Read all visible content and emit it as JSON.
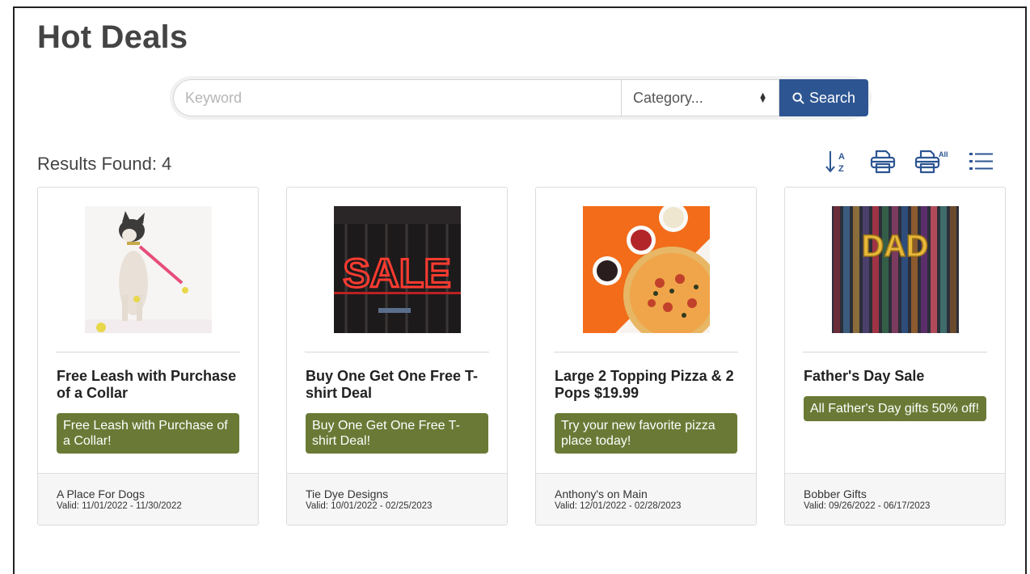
{
  "page": {
    "title": "Hot Deals"
  },
  "search": {
    "keyword_placeholder": "Keyword",
    "category_selected": "Category...",
    "button_label": "Search"
  },
  "results": {
    "label": "Results Found:",
    "count": "4"
  },
  "toolbar": {
    "print_all_label": "All"
  },
  "colors": {
    "accent": "#2d5592",
    "badge": "#6a7a36"
  },
  "deals": [
    {
      "title": "Free Leash with Purchase of a Collar",
      "description": "Free Leash with Purchase of a Collar!",
      "merchant": "A Place For Dogs",
      "valid": "Valid: 11/01/2022 - 11/30/2022"
    },
    {
      "title": "Buy One Get One Free T-shirt Deal",
      "description": "Buy One Get One Free T-shirt Deal!",
      "merchant": "Tie Dye Designs",
      "valid": "Valid: 10/01/2022 - 02/25/2023"
    },
    {
      "title": "Large 2 Topping Pizza & 2 Pops $19.99",
      "description": "Try your new favorite pizza place today!",
      "merchant": "Anthony's on Main",
      "valid": "Valid: 12/01/2022 - 02/28/2023"
    },
    {
      "title": "Father's Day Sale",
      "description": "All Father's Day gifts 50% off!",
      "merchant": "Bobber Gifts",
      "valid": "Valid: 09/26/2022 - 06/17/2023"
    }
  ],
  "images": {
    "sale_sign": "SALE",
    "dad_balloons": "DAD"
  }
}
